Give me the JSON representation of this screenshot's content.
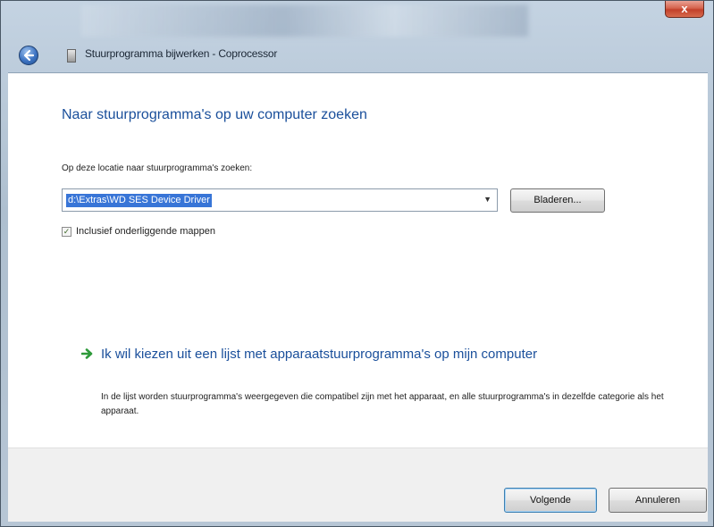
{
  "window": {
    "title": "Stuurprogramma bijwerken - Coprocessor",
    "close_label": "x"
  },
  "content": {
    "heading": "Naar stuurprogramma's op uw computer zoeken",
    "location_label": "Op deze locatie naar stuurprogramma's zoeken:",
    "location_value": "d:\\Extras\\WD SES Device Driver",
    "browse_label": "Bladeren...",
    "include_subfolders_label": "Inclusief onderliggende mappen",
    "include_subfolders_checked": true,
    "option_title": "Ik wil kiezen uit een lijst met apparaatstuurprogramma's op mijn computer",
    "option_description": "In de lijst worden stuurprogramma's weergegeven die compatibel zijn met het apparaat, en alle stuurprogramma's in dezelfde categorie als het apparaat."
  },
  "footer": {
    "next_label": "Volgende",
    "cancel_label": "Annuleren"
  },
  "icons": {
    "back": "back-arrow-icon",
    "device": "device-icon",
    "option_arrow": "green-arrow-icon"
  },
  "colors": {
    "heading": "#1a4f9b",
    "selection": "#3875d7",
    "option_arrow": "#2e9a3a"
  }
}
